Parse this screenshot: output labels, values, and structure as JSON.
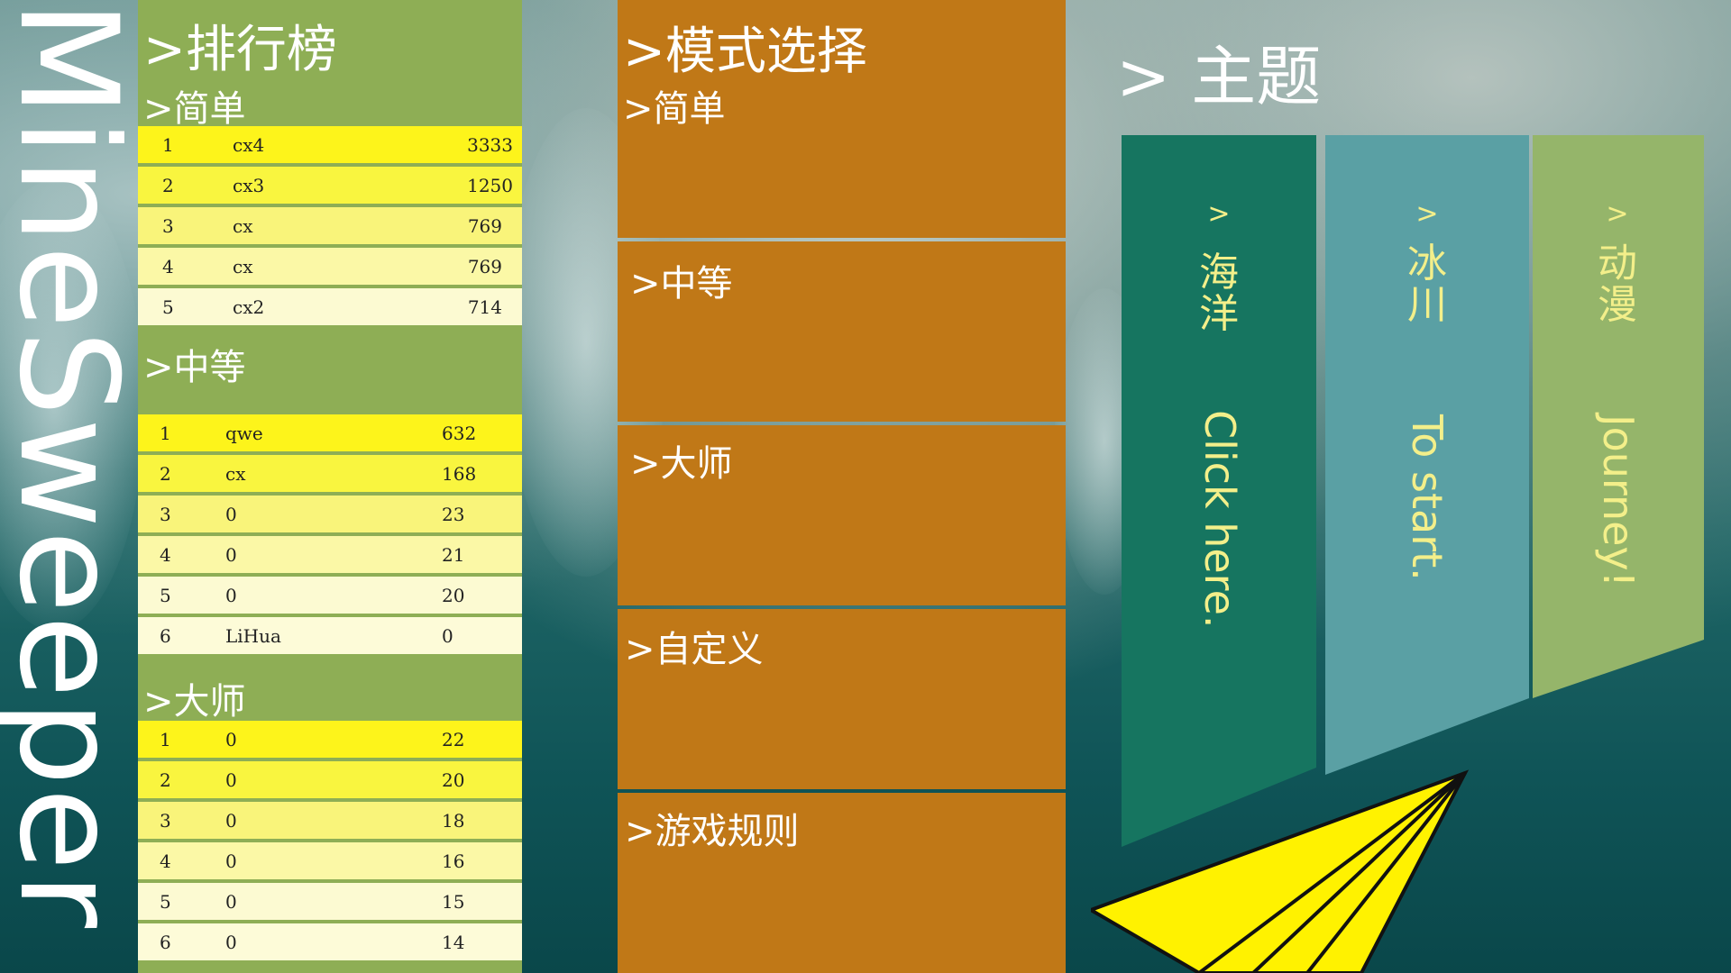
{
  "app": {
    "title": "MineSweeper"
  },
  "leaderboard": {
    "title": ">排行榜",
    "sections": [
      {
        "heading": ">简单",
        "rows": [
          {
            "rank": "1",
            "name": "cx4",
            "score": "3333"
          },
          {
            "rank": "2",
            "name": "cx3",
            "score": "1250"
          },
          {
            "rank": "3",
            "name": "cx",
            "score": "769"
          },
          {
            "rank": "4",
            "name": "cx",
            "score": "769"
          },
          {
            "rank": "5",
            "name": "cx2",
            "score": "714"
          }
        ]
      },
      {
        "heading": ">中等",
        "rows": [
          {
            "rank": "1",
            "name": "qwe",
            "score": "632"
          },
          {
            "rank": "2",
            "name": "cx",
            "score": "168"
          },
          {
            "rank": "3",
            "name": "0",
            "score": "23"
          },
          {
            "rank": "4",
            "name": "0",
            "score": "21"
          },
          {
            "rank": "5",
            "name": "0",
            "score": "20"
          },
          {
            "rank": "6",
            "name": "LiHua",
            "score": "0"
          }
        ]
      },
      {
        "heading": ">大师",
        "rows": [
          {
            "rank": "1",
            "name": "0",
            "score": "22"
          },
          {
            "rank": "2",
            "name": "0",
            "score": "20"
          },
          {
            "rank": "3",
            "name": "0",
            "score": "18"
          },
          {
            "rank": "4",
            "name": "0",
            "score": "16"
          },
          {
            "rank": "5",
            "name": "0",
            "score": "15"
          },
          {
            "rank": "6",
            "name": "0",
            "score": "14"
          }
        ]
      }
    ]
  },
  "mode_select": {
    "title": ">模式选择",
    "modes": [
      {
        "label": ">简单"
      },
      {
        "label": ">中等"
      },
      {
        "label": ">大师"
      },
      {
        "label": ">自定义"
      },
      {
        "label": ">游戏规则"
      }
    ]
  },
  "theme": {
    "title": "> 主题",
    "cards": [
      {
        "chevron": ">",
        "name": "海洋",
        "caption": "Click here.",
        "color": "#167560"
      },
      {
        "chevron": ">",
        "name": "冰川",
        "caption": "To start.",
        "color": "#5aa0a4"
      },
      {
        "chevron": ">",
        "name": "动漫",
        "caption": "Journey!",
        "color": "#95b56a"
      }
    ]
  },
  "colors": {
    "leaderboard_bg": "#8eae55",
    "mode_bg": "#c07817",
    "accent_yellow": "#fdf41b",
    "plane": "#fff200"
  },
  "icons": {
    "paper_plane": "paper-plane-icon"
  }
}
